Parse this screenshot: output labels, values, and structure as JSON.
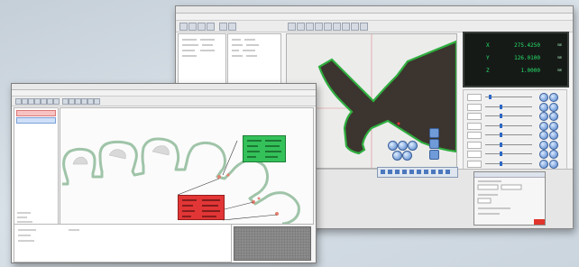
{
  "back_window": {
    "title": "",
    "menu": [
      "",
      "",
      "",
      "",
      "",
      "",
      ""
    ],
    "left_panel_1": [
      "",
      "",
      "",
      ""
    ],
    "left_panel_2": [
      "",
      "",
      "",
      "",
      ""
    ],
    "dro": [
      {
        "axis": "X",
        "value": "275.4250",
        "unit": "mm"
      },
      {
        "axis": "Y",
        "value": "126.0100",
        "unit": "mm"
      },
      {
        "axis": "Z",
        "value": "1.0000",
        "unit": "mm"
      }
    ],
    "controls": [
      {
        "label": "",
        "level": 0.08
      },
      {
        "label": "",
        "level": 0.3
      },
      {
        "label": "",
        "level": 0.3
      },
      {
        "label": "",
        "level": 0.3
      },
      {
        "label": "",
        "level": 0.3
      },
      {
        "label": "",
        "level": 0.3
      },
      {
        "label": "",
        "level": 0.3
      },
      {
        "label": "",
        "level": 0.3
      }
    ],
    "dialog": {
      "title": "",
      "lines": [
        "",
        "",
        "",
        "",
        ""
      ]
    }
  },
  "front_window": {
    "title": "",
    "menu": [
      "",
      "",
      "",
      "",
      "",
      ""
    ],
    "tree_items": [
      "",
      ""
    ],
    "green_label": [
      "",
      "",
      "",
      ""
    ],
    "red_label": [
      "",
      "",
      "",
      ""
    ],
    "bottom_lines": [
      "",
      "",
      ""
    ]
  },
  "colors": {
    "background": "#d2dbe3",
    "part_fill": "#3c342e",
    "part_outline": "#2fae3f",
    "profile_outline": "#9fc4a8",
    "measure_red": "#e23636",
    "measure_green": "#34c15a",
    "dro_green": "#28e06a",
    "button_blue": "#4c7fc9"
  }
}
